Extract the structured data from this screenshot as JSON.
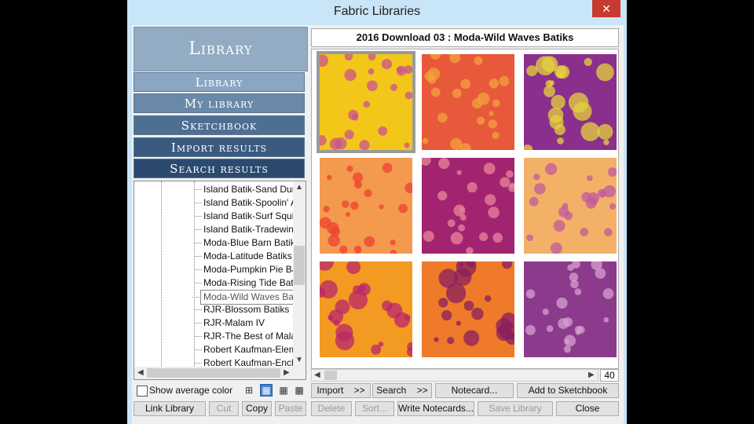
{
  "window": {
    "title": "Fabric Libraries",
    "close_glyph": "✕"
  },
  "library": {
    "header": "Library",
    "nav": [
      "Library",
      "My library",
      "Sketchbook",
      "Import results",
      "Search results"
    ]
  },
  "tree": {
    "items": [
      "Island Batik-Sand Dun",
      "Island Batik-Spoolin' A",
      "Island Batik-Surf Squir",
      "Island Batik-Tradewind",
      "Moda-Blue Barn Batik",
      "Moda-Latitude Batiks",
      "Moda-Pumpkin Pie Ba",
      "Moda-Rising Tide Bati",
      "Moda-Wild Waves Batiks",
      "RJR-Blossom Batiks",
      "RJR-Malam IV",
      "RJR-The Best of Mala",
      "Robert Kaufman-Elem",
      "Robert Kaufman-Ench"
    ],
    "selected_index": 8
  },
  "fabric_title": "2016 Download 03  :  Moda-Wild Waves Batiks",
  "fabric_count": "40",
  "swatches": [
    {
      "name": "yellow-dots",
      "base": "#f2c71a",
      "accent": "#c9538f"
    },
    {
      "name": "orange-red-dots",
      "base": "#e8583a",
      "accent": "#f3a23e"
    },
    {
      "name": "purple-leaves",
      "base": "#8a2f8c",
      "accent": "#e6d33b"
    },
    {
      "name": "orange-flower",
      "base": "#f49a4f",
      "accent": "#ee4030"
    },
    {
      "name": "magenta-dots",
      "base": "#a22470",
      "accent": "#e9869a"
    },
    {
      "name": "peach-dots",
      "base": "#f3b168",
      "accent": "#c35a9e"
    },
    {
      "name": "orange-fern",
      "base": "#f39a22",
      "accent": "#b9266a"
    },
    {
      "name": "orange-wave",
      "base": "#ef7a2a",
      "accent": "#8a1f5e"
    },
    {
      "name": "plum-dots",
      "base": "#8c3a8c",
      "accent": "#d5a0d0"
    }
  ],
  "controls": {
    "show_avg_color": "Show average color",
    "import": "Import",
    "search": "Search",
    "chev": ">>",
    "notecard": "Notecard...",
    "add_sketchbook": "Add to Sketchbook",
    "link_library": "Link Library",
    "cut": "Cut",
    "copy": "Copy",
    "paste": "Paste",
    "delete": "Delete",
    "sort": "Sort...",
    "write_notecards": "Write Notecards...",
    "save_library": "Save Library",
    "close": "Close"
  },
  "colors": {
    "nav_dark": "#2c4a70",
    "nav_mid": "#4f6f92",
    "nav_light": "#8ba6c2",
    "window_frame": "#c9e5f8"
  }
}
